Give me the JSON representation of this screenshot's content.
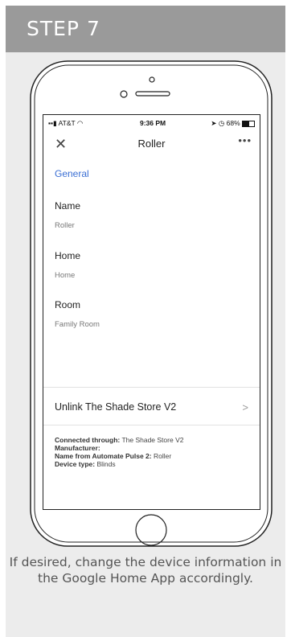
{
  "step": {
    "title": "STEP 7"
  },
  "phone": {
    "status": {
      "carrier": "AT&T",
      "time": "9:36 PM",
      "battery": "68%"
    },
    "topbar": {
      "close": "✕",
      "title": "Roller",
      "more": "•••"
    },
    "section": "General",
    "fields": [
      {
        "label": "Name",
        "value": "Roller"
      },
      {
        "label": "Home",
        "value": "Home"
      },
      {
        "label": "Room",
        "value": "Family Room"
      }
    ],
    "unlink": {
      "label": "Unlink The Shade Store V2",
      "chevron": ">"
    },
    "info": {
      "connected_label": "Connected through:",
      "connected_value": "The Shade Store V2",
      "manufacturer_label": "Manufacturer:",
      "name_label": "Name from Automate Pulse 2:",
      "name_value": "Roller",
      "type_label": "Device type:",
      "type_value": "Blinds"
    }
  },
  "caption": "If desired, change the device information in the Google Home App accordingly."
}
